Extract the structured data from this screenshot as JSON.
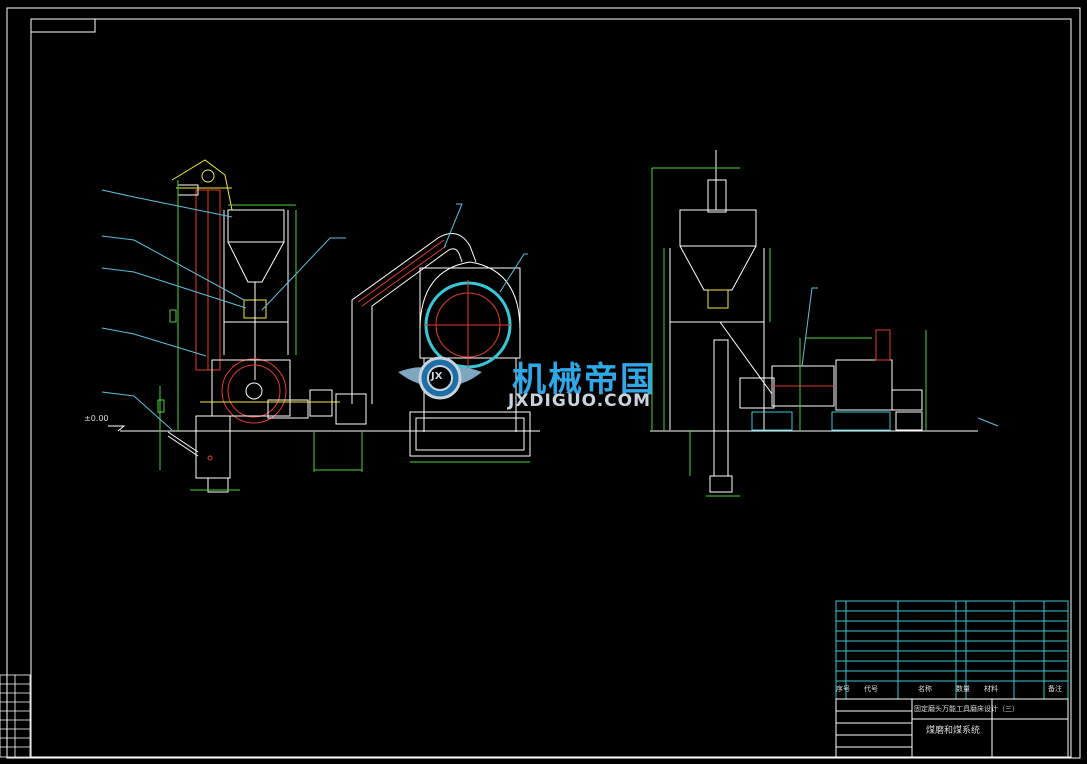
{
  "watermark": {
    "chinese": "机械帝国",
    "english": "JXDIGUO.COM",
    "badge": "JX"
  },
  "datum_label": "±0.00",
  "title_block": {
    "col_seq": "序号",
    "col_code": "代号",
    "col_name": "名称",
    "col_qty": "数量",
    "col_material": "材料",
    "col_remark": "备注",
    "project_title": "固定磨头万能工具磨床设计（三）",
    "drawing_title": "煤磨和煤系统"
  },
  "colors": {
    "frame": "#ffffff",
    "structure": "#ffffff",
    "dimension": "#4cd137",
    "leader": "#5bc0de",
    "equipment_red": "#e23b2e",
    "equipment_yellow": "#f4e842",
    "cyan_ring": "#37c8d8",
    "title_block": "#37c8d8",
    "watermark_blue": "#2fa8e8"
  }
}
